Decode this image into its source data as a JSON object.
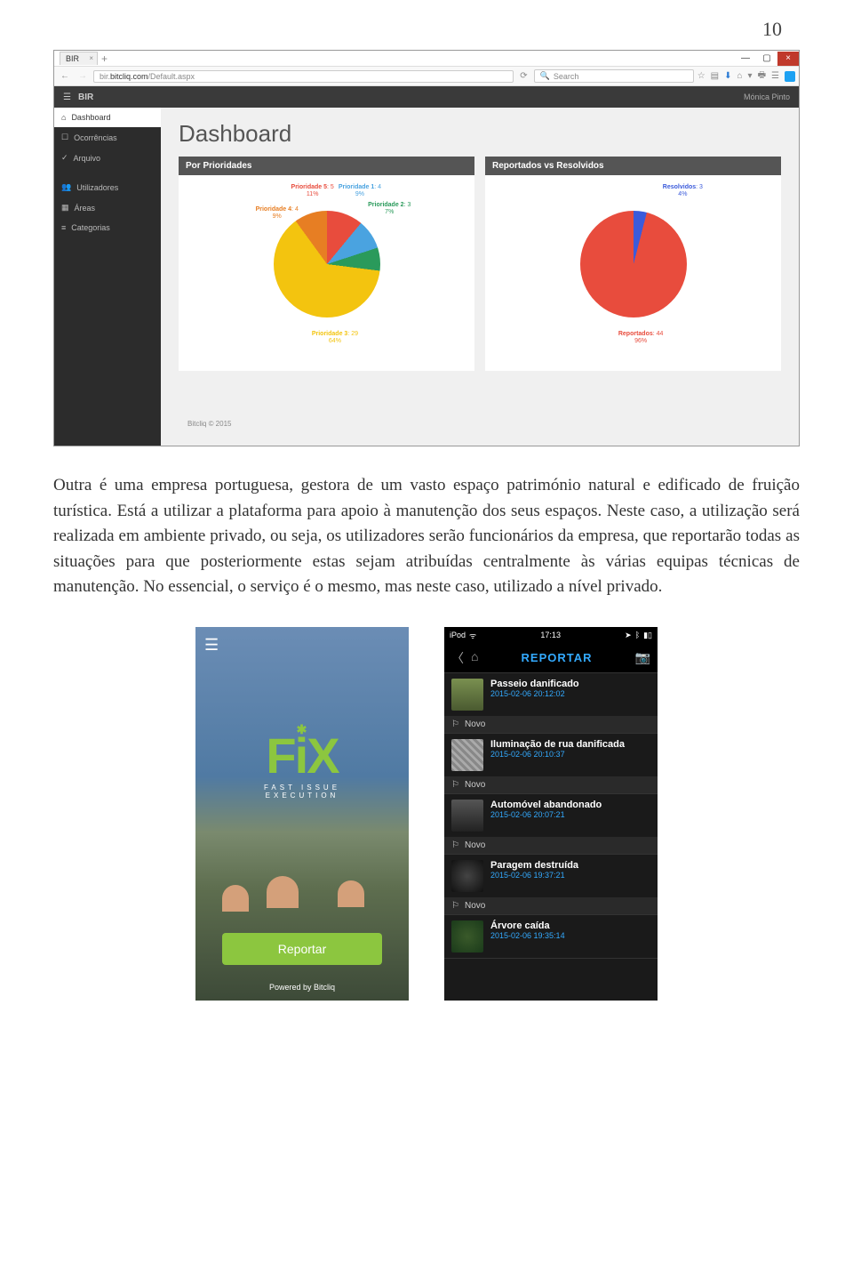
{
  "page_number": "10",
  "browser": {
    "tab_title": "BIR",
    "url_host": "bir.bitcliq.com",
    "url_path": "/Default.aspx",
    "search_placeholder": "Search"
  },
  "app": {
    "brand": "BIR",
    "user": "Mónica Pinto",
    "sidebar": [
      {
        "label": "Dashboard"
      },
      {
        "label": "Ocorrências"
      },
      {
        "label": "Arquivo"
      },
      {
        "label": "Utilizadores"
      },
      {
        "label": "Áreas"
      },
      {
        "label": "Categorias"
      }
    ],
    "page_title": "Dashboard",
    "panel1_title": "Por Prioridades",
    "panel2_title": "Reportados vs Resolvidos",
    "footer": "Bitcliq © 2015"
  },
  "body_text": "Outra é uma empresa portuguesa, gestora de um vasto espaço património natural e edificado de fruição turística. Está a utilizar a plataforma para apoio à manutenção dos seus espaços. Neste caso, a utilização será realizada em ambiente privado, ou seja, os utilizadores serão funcionários da empresa, que reportarão todas as situações para que posteriormente estas sejam atribuídas centralmente às várias equipas técnicas de manutenção. No essencial, o serviço é o mesmo, mas neste caso, utilizado a nível privado.",
  "phone1": {
    "logo": "FiX",
    "tagline": "FAST ISSUE EXECUTION",
    "button": "Reportar",
    "powered": "Powered by Bitcliq"
  },
  "phone2": {
    "status_device": "iPod",
    "status_time": "17:13",
    "nav_title": "REPORTAR",
    "items": [
      {
        "title": "Passeio danificado",
        "date": "2015-02-06 20:12:02",
        "status": "Novo"
      },
      {
        "title": "Iluminação de rua danificada",
        "date": "2015-02-06 20:10:37",
        "status": "Novo"
      },
      {
        "title": "Automóvel abandonado",
        "date": "2015-02-06 20:07:21",
        "status": "Novo"
      },
      {
        "title": "Paragem destruída",
        "date": "2015-02-06 19:37:21",
        "status": "Novo"
      },
      {
        "title": "Árvore caída",
        "date": "2015-02-06 19:35:14",
        "status": ""
      }
    ]
  },
  "chart_data": [
    {
      "type": "pie",
      "title": "Por Prioridades",
      "series": [
        {
          "name": "Prioridade 5",
          "count": 5,
          "percent": 11
        },
        {
          "name": "Prioridade 1",
          "count": 4,
          "percent": 9
        },
        {
          "name": "Prioridade 2",
          "count": 3,
          "percent": 7
        },
        {
          "name": "Prioridade 3",
          "count": 29,
          "percent": 64
        },
        {
          "name": "Prioridade 4",
          "count": 4,
          "percent": 9
        }
      ]
    },
    {
      "type": "pie",
      "title": "Reportados vs Resolvidos",
      "series": [
        {
          "name": "Resolvidos",
          "count": 3,
          "percent": 4
        },
        {
          "name": "Reportados",
          "count": 44,
          "percent": 96
        }
      ]
    }
  ]
}
